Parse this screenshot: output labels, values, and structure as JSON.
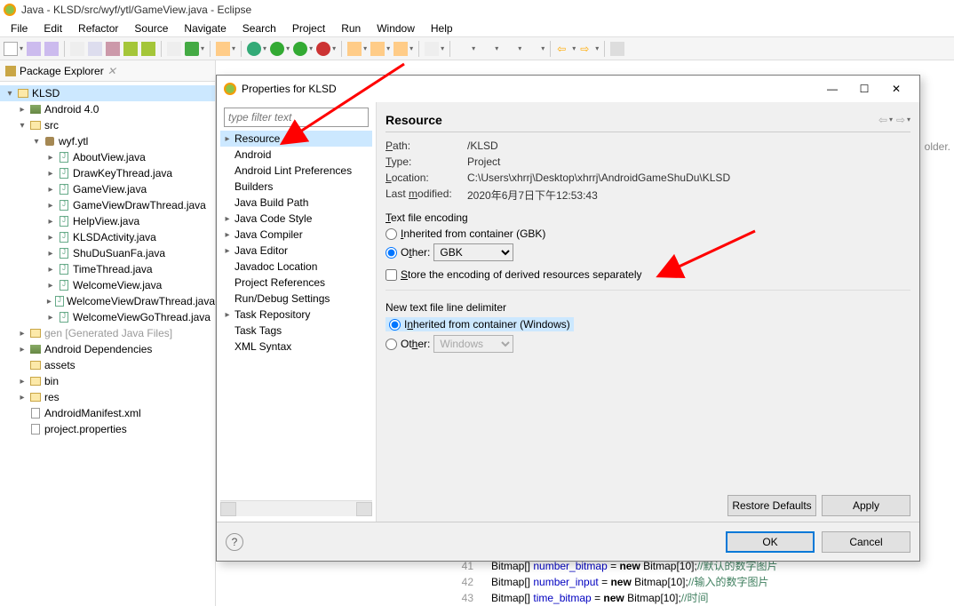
{
  "window": {
    "title": "Java - KLSD/src/wyf/ytl/GameView.java - Eclipse"
  },
  "menu": [
    "File",
    "Edit",
    "Refactor",
    "Source",
    "Navigate",
    "Search",
    "Project",
    "Run",
    "Window",
    "Help"
  ],
  "packageExplorer": {
    "title": "Package Explorer",
    "tree": [
      {
        "label": "KLSD",
        "type": "project",
        "indent": 0,
        "arrow": "▾",
        "selected": true
      },
      {
        "label": "Android 4.0",
        "type": "lib",
        "indent": 1,
        "arrow": "▸"
      },
      {
        "label": "src",
        "type": "folder",
        "indent": 1,
        "arrow": "▾"
      },
      {
        "label": "wyf.ytl",
        "type": "pkg",
        "indent": 2,
        "arrow": "▾"
      },
      {
        "label": "AboutView.java",
        "type": "java",
        "indent": 3,
        "arrow": "▸"
      },
      {
        "label": "DrawKeyThread.java",
        "type": "java",
        "indent": 3,
        "arrow": "▸"
      },
      {
        "label": "GameView.java",
        "type": "java",
        "indent": 3,
        "arrow": "▸"
      },
      {
        "label": "GameViewDrawThread.java",
        "type": "java",
        "indent": 3,
        "arrow": "▸"
      },
      {
        "label": "HelpView.java",
        "type": "java",
        "indent": 3,
        "arrow": "▸"
      },
      {
        "label": "KLSDActivity.java",
        "type": "java",
        "indent": 3,
        "arrow": "▸"
      },
      {
        "label": "ShuDuSuanFa.java",
        "type": "java",
        "indent": 3,
        "arrow": "▸"
      },
      {
        "label": "TimeThread.java",
        "type": "java",
        "indent": 3,
        "arrow": "▸"
      },
      {
        "label": "WelcomeView.java",
        "type": "java",
        "indent": 3,
        "arrow": "▸"
      },
      {
        "label": "WelcomeViewDrawThread.java",
        "type": "java",
        "indent": 3,
        "arrow": "▸"
      },
      {
        "label": "WelcomeViewGoThread.java",
        "type": "java",
        "indent": 3,
        "arrow": "▸"
      },
      {
        "label": "gen [Generated Java Files]",
        "type": "folder",
        "indent": 1,
        "arrow": "▸",
        "gen": true
      },
      {
        "label": "Android Dependencies",
        "type": "lib",
        "indent": 1,
        "arrow": "▸"
      },
      {
        "label": "assets",
        "type": "folder",
        "indent": 1,
        "arrow": ""
      },
      {
        "label": "bin",
        "type": "folder",
        "indent": 1,
        "arrow": "▸"
      },
      {
        "label": "res",
        "type": "folder",
        "indent": 1,
        "arrow": "▸"
      },
      {
        "label": "AndroidManifest.xml",
        "type": "file",
        "indent": 1,
        "arrow": ""
      },
      {
        "label": "project.properties",
        "type": "file",
        "indent": 1,
        "arrow": ""
      }
    ]
  },
  "dialog": {
    "title": "Properties for KLSD",
    "filter_placeholder": "type filter text",
    "categories": [
      {
        "label": "Resource",
        "arrow": "▸",
        "selected": true
      },
      {
        "label": "Android",
        "arrow": ""
      },
      {
        "label": "Android Lint Preferences",
        "arrow": ""
      },
      {
        "label": "Builders",
        "arrow": ""
      },
      {
        "label": "Java Build Path",
        "arrow": ""
      },
      {
        "label": "Java Code Style",
        "arrow": "▸"
      },
      {
        "label": "Java Compiler",
        "arrow": "▸"
      },
      {
        "label": "Java Editor",
        "arrow": "▸"
      },
      {
        "label": "Javadoc Location",
        "arrow": ""
      },
      {
        "label": "Project References",
        "arrow": ""
      },
      {
        "label": "Run/Debug Settings",
        "arrow": ""
      },
      {
        "label": "Task Repository",
        "arrow": "▸"
      },
      {
        "label": "Task Tags",
        "arrow": ""
      },
      {
        "label": "XML Syntax",
        "arrow": ""
      }
    ],
    "heading": "Resource",
    "props": {
      "path_label": "Path:",
      "path_value": "/KLSD",
      "type_label": "Type:",
      "type_value": "Project",
      "location_label": "Location:",
      "location_value": "C:\\Users\\xhrrj\\Desktop\\xhrrj\\AndroidGameShuDu\\KLSD",
      "modified_label": "Last modified:",
      "modified_value": "2020年6月7日下午12:53:43"
    },
    "encoding": {
      "group_label": "Text file encoding",
      "inherited_label": "Inherited from container (GBK)",
      "other_label": "Other:",
      "other_value": "GBK",
      "store_label": "Store the encoding of derived resources separately"
    },
    "delimiter": {
      "group_label": "New text file line delimiter",
      "inherited_label": "Inherited from container (Windows)",
      "other_label": "Other:",
      "other_value": "Windows"
    },
    "buttons": {
      "restore": "Restore Defaults",
      "apply": "Apply",
      "ok": "OK",
      "cancel": "Cancel"
    }
  },
  "code": {
    "l41_num": "41",
    "l41_a": "Bitmap[] ",
    "l41_b": "number_bitmap",
    "l41_c": " = ",
    "l41_d": "new",
    "l41_e": " Bitmap[10];",
    "l41_f": "//默认的数字图片",
    "l42_num": "42",
    "l42_a": "Bitmap[] ",
    "l42_b": "number_input",
    "l42_c": " = ",
    "l42_d": "new",
    "l42_e": " Bitmap[10];",
    "l42_f": "//输入的数字图片",
    "l43_num": "43",
    "l43_a": "Bitmap[] ",
    "l43_b": "time_bitmap",
    "l43_c": " = ",
    "l43_d": "new",
    "l43_e": " Bitmap[10];",
    "l43_f": "//时间"
  },
  "editor_hint": "older."
}
